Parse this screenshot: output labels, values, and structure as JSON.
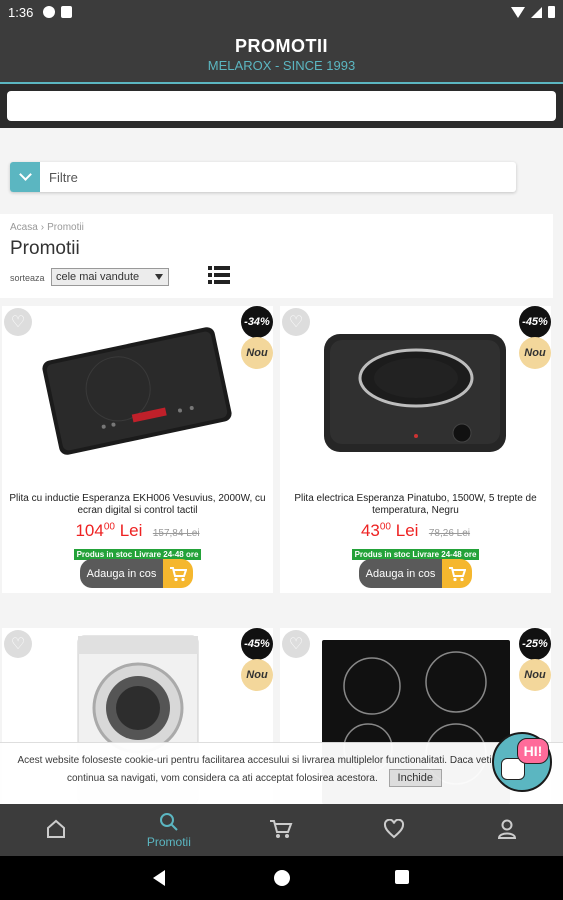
{
  "status_bar": {
    "time": "1:36"
  },
  "app_bar": {
    "title": "PROMOTII",
    "subtitle": "MELAROX - SINCE 1993"
  },
  "search": {
    "value": ""
  },
  "filter": {
    "label": "Filtre"
  },
  "breadcrumb": {
    "home": "Acasa",
    "separator": "›",
    "current": "Promotii"
  },
  "page": {
    "title": "Promotii",
    "sort_label": "sorteaza",
    "sort_value": "cele mai vandute"
  },
  "products": [
    {
      "name": "Plita cu inductie Esperanza EKH006 Vesuvius, 2000W, cu ecran digital si control tactil",
      "discount": "-34%",
      "badge": "Nou",
      "price_int": "104",
      "price_dec": "00",
      "currency": "Lei",
      "old_price": "157,84 Lei",
      "stock": "Produs in stoc Livrare 24-48 ore",
      "add_label": "Adauga in cos"
    },
    {
      "name": "Plita electrica Esperanza Pinatubo, 1500W, 5 trepte de temperatura, Negru",
      "discount": "-45%",
      "badge": "Nou",
      "price_int": "43",
      "price_dec": "00",
      "currency": "Lei",
      "old_price": "78,26 Lei",
      "stock": "Produs in stoc Livrare 24-48 ore",
      "add_label": "Adauga in cos"
    },
    {
      "discount": "-45%",
      "badge": "Nou"
    },
    {
      "discount": "-25%",
      "badge": "Nou"
    }
  ],
  "cookie": {
    "text": "Acest website foloseste cookie-uri pentru facilitarea accesului si livrarea multiplelor functionalitati. Daca veti continua sa navigati, vom considera ca ati acceptat folosirea acestora.",
    "button": "Inchide"
  },
  "chat_bubble": {
    "label": "HI!"
  },
  "bottom_nav": [
    {
      "icon": "home-icon",
      "label": ""
    },
    {
      "icon": "search-icon",
      "label": "Promotii"
    },
    {
      "icon": "cart-icon",
      "label": ""
    },
    {
      "icon": "heart-icon",
      "label": ""
    },
    {
      "icon": "user-icon",
      "label": ""
    }
  ],
  "colors": {
    "accent": "#5bb6c1",
    "price_red": "#ee2222",
    "stock_green": "#23a239",
    "cart_yellow": "#f5b72e",
    "bar_dark": "#3c3c3c"
  }
}
